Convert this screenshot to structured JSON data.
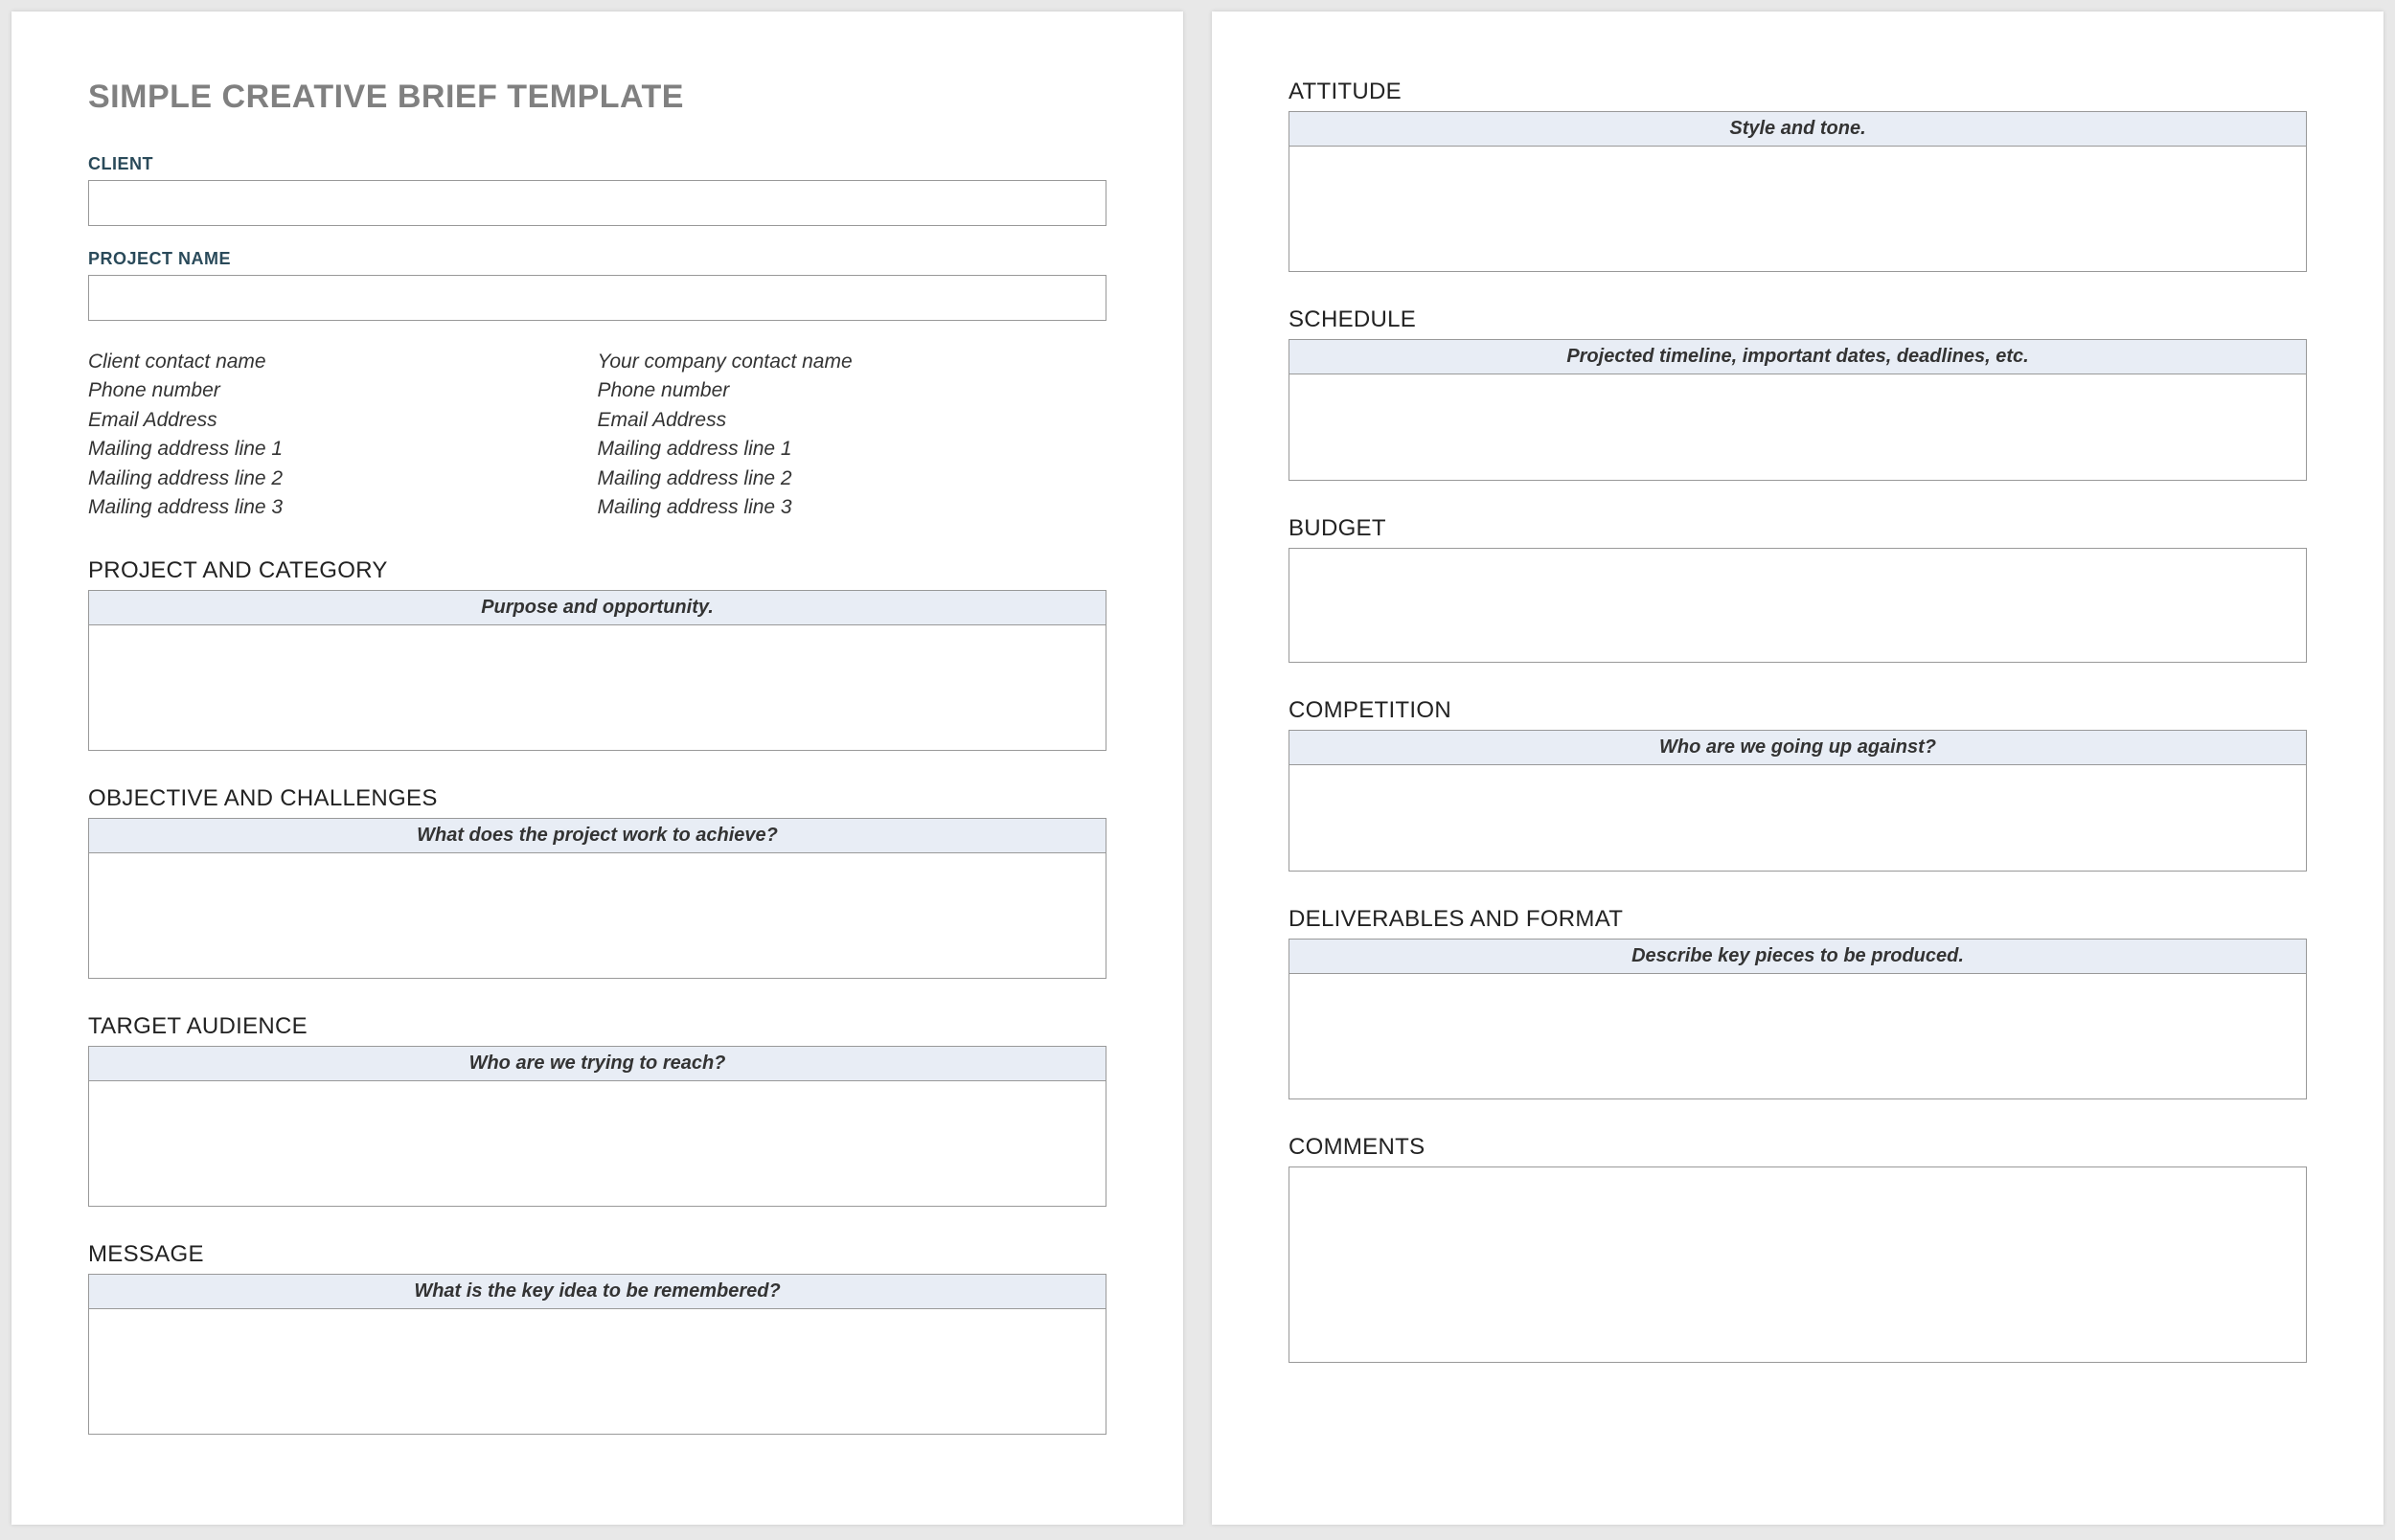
{
  "title": "SIMPLE CREATIVE BRIEF TEMPLATE",
  "clientLabel": "CLIENT",
  "projectNameLabel": "PROJECT NAME",
  "clientContact": {
    "name": "Client contact name",
    "phone": "Phone number",
    "email": "Email Address",
    "addr1": "Mailing address line 1",
    "addr2": "Mailing address line 2",
    "addr3": "Mailing address line 3"
  },
  "companyContact": {
    "name": "Your company contact name",
    "phone": "Phone number",
    "email": "Email Address",
    "addr1": "Mailing address line 1",
    "addr2": "Mailing address line 2",
    "addr3": "Mailing address line 3"
  },
  "sections": {
    "projectCategory": {
      "heading": "PROJECT AND CATEGORY",
      "prompt": "Purpose and opportunity."
    },
    "objective": {
      "heading": "OBJECTIVE AND CHALLENGES",
      "prompt": "What does the project work to achieve?"
    },
    "audience": {
      "heading": "TARGET AUDIENCE",
      "prompt": "Who are we trying to reach?"
    },
    "message": {
      "heading": "MESSAGE",
      "prompt": "What is the key idea to be remembered?"
    },
    "attitude": {
      "heading": "ATTITUDE",
      "prompt": "Style and tone."
    },
    "schedule": {
      "heading": "SCHEDULE",
      "prompt": "Projected timeline, important dates, deadlines, etc."
    },
    "budget": {
      "heading": "BUDGET"
    },
    "competition": {
      "heading": "COMPETITION",
      "prompt": "Who are we going up against?"
    },
    "deliverables": {
      "heading": "DELIVERABLES AND FORMAT",
      "prompt": "Describe key pieces to be produced."
    },
    "comments": {
      "heading": "COMMENTS"
    }
  }
}
